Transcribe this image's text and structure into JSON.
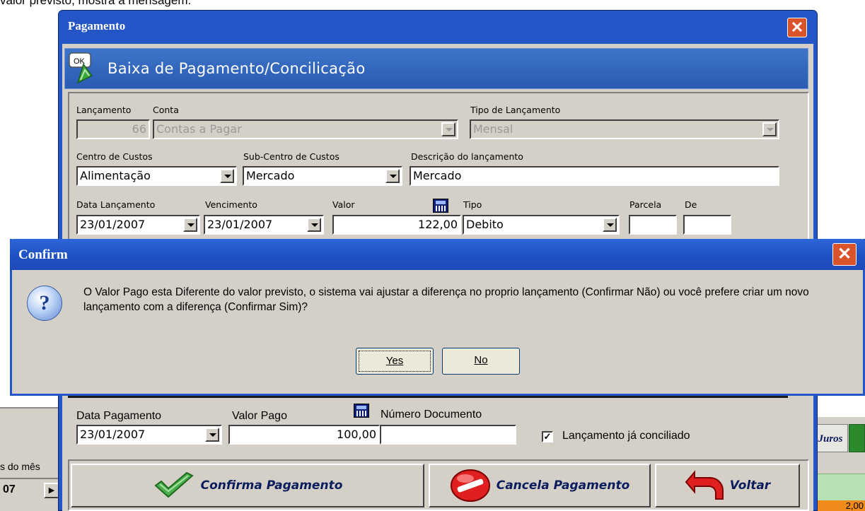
{
  "top_text": "valor previsto, mostra a mensagem:",
  "background": {
    "left_text": "s do mês",
    "left_year": "07",
    "right_button": "Juros",
    "right_value": "2,00"
  },
  "window": {
    "title": "Pagamento",
    "banner_title": "Baixa de Pagamento/Concilicação",
    "ok_icon_label": "OK"
  },
  "form": {
    "lancamento_label": "Lançamento",
    "lancamento_value": "66",
    "conta_label": "Conta",
    "conta_value": "Contas a Pagar",
    "tipo_lancamento_label": "Tipo de Lançamento",
    "tipo_lancamento_value": "Mensal",
    "centro_label": "Centro de Custos",
    "centro_value": "Alimentação",
    "subcentro_label": "Sub-Centro de Custos",
    "subcentro_value": "Mercado",
    "descricao_label": "Descrição do lançamento",
    "descricao_value": "Mercado",
    "data_lanc_label": "Data Lançamento",
    "data_lanc_value": "23/01/2007",
    "vencimento_label": "Vencimento",
    "vencimento_value": "23/01/2007",
    "valor_label": "Valor",
    "valor_value": "122,00",
    "tipo_label": "Tipo",
    "tipo_value": "Debito",
    "parcela_label": "Parcela",
    "parcela_value": "",
    "de_label": "De",
    "de_value": ""
  },
  "payment": {
    "data_pag_label": "Data Pagamento",
    "data_pag_value": "23/01/2007",
    "valor_pago_label": "Valor Pago",
    "valor_pago_value": "100,00",
    "num_doc_label": "Número Documento",
    "num_doc_value": "",
    "conciliado_label": "Lançamento já conciliado",
    "conciliado_checked": true
  },
  "buttons": {
    "confirma": "Confirma Pagamento",
    "cancela": "Cancela Pagamento",
    "voltar": "Voltar"
  },
  "dialog": {
    "title": "Confirm",
    "message": "O Valor Pago esta Diferente do valor previsto, o sistema vai ajustar a diferença no proprio lançamento (Confirmar Não) ou você prefere criar um novo lançamento com a diferença (Confirmar Sim)?",
    "yes_label": "Yes",
    "no_label": "No",
    "icon": "question-icon"
  },
  "colors": {
    "titlebar": "#2456c8",
    "face": "#d4d0c8",
    "close": "#d9532b"
  }
}
